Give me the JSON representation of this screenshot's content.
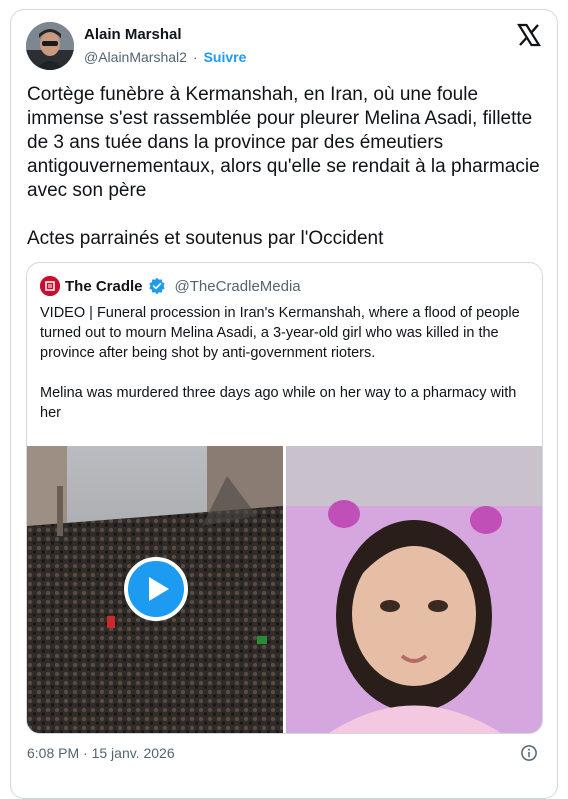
{
  "author": {
    "name": "Alain Marshal",
    "handle": "@AlainMarshal2",
    "separator": "·",
    "follow_label": "Suivre"
  },
  "tweet": {
    "text": "Cortège funèbre à Kermanshah, en Iran, où une foule immense s'est rassemblée pour pleurer Melina Asadi, fillette de 3 ans tuée dans la province par des émeutiers antigouvernementaux, alors qu'elle se rendait à la pharmacie avec son père\n\nActes parrainés et soutenus par l'Occident",
    "timestamp": "6:08 PM · 15 janv. 2026"
  },
  "quoted": {
    "name": "The Cradle",
    "handle": "@TheCradleMedia",
    "verified": true,
    "text": "VIDEO | Funeral procession in Iran's Kermanshah, where a flood of people turned out to mourn Melina Asadi, a 3-year-old girl who was killed in the province after being shot by anti-government rioters.\n\nMelina was murdered three days ago while on her way to a pharmacy with her",
    "media": [
      {
        "kind": "video",
        "description": "crowd-funeral-procession"
      },
      {
        "kind": "image",
        "description": "child-portrait"
      }
    ]
  },
  "icons": {
    "x_logo": "x-logo-icon",
    "verified": "verified-badge-icon",
    "play": "play-icon",
    "info": "info-icon"
  },
  "colors": {
    "accent": "#1d9bf0",
    "text": "#0f1419",
    "muted": "#536471",
    "border": "#cfd9de"
  }
}
